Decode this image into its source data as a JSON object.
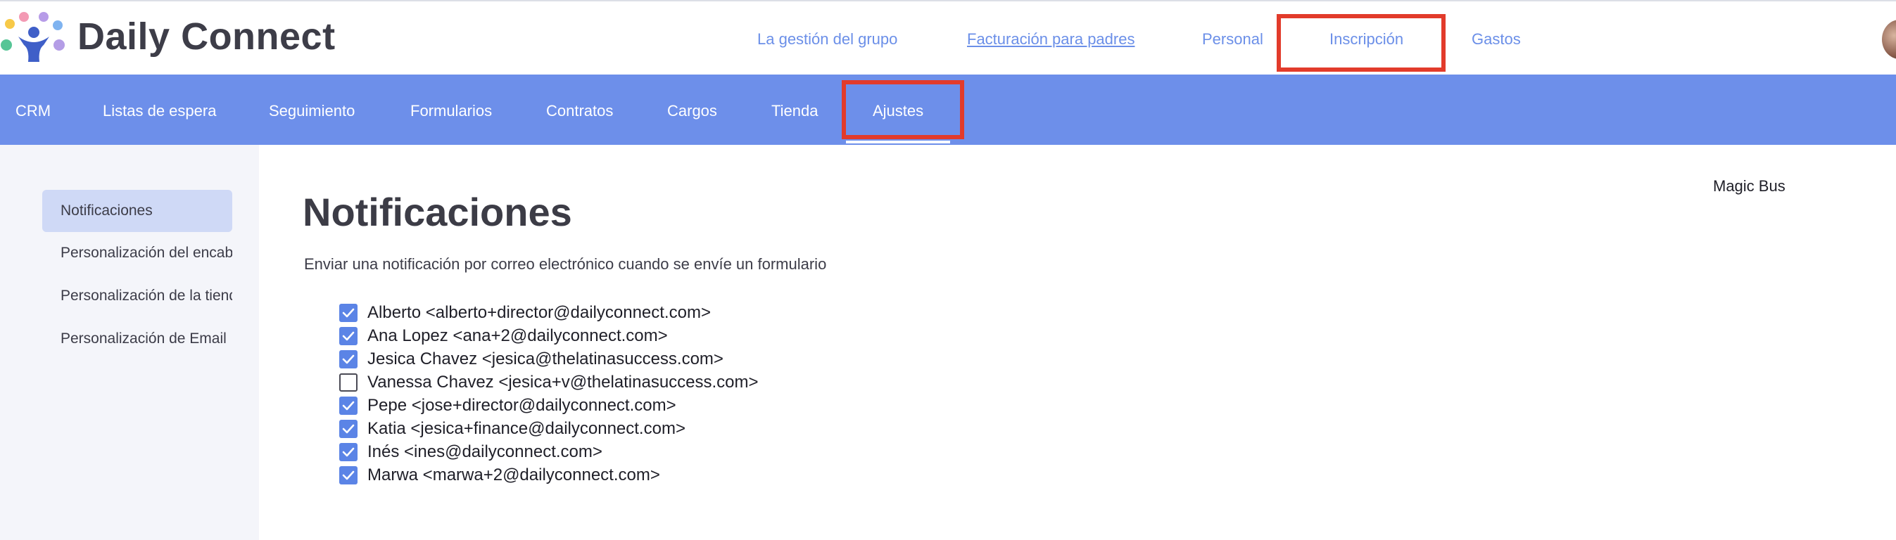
{
  "brand": {
    "name": "Daily Connect"
  },
  "top_nav": {
    "items": [
      {
        "label": "La gestión del grupo"
      },
      {
        "label": "Facturación para padres"
      },
      {
        "label": "Personal"
      },
      {
        "label": "Inscripción"
      },
      {
        "label": "Gastos"
      }
    ]
  },
  "sub_nav": {
    "items": [
      {
        "label": "CRM"
      },
      {
        "label": "Listas de espera"
      },
      {
        "label": "Seguimiento"
      },
      {
        "label": "Formularios"
      },
      {
        "label": "Contratos"
      },
      {
        "label": "Cargos"
      },
      {
        "label": "Tienda"
      },
      {
        "label": "Ajustes"
      }
    ],
    "school_select": {
      "value": "Magic Bus"
    }
  },
  "sidebar": {
    "items": [
      {
        "label": "Notificaciones"
      },
      {
        "label": "Personalización del encabezado"
      },
      {
        "label": "Personalización de la tienda"
      },
      {
        "label": "Personalización de Email"
      }
    ]
  },
  "main": {
    "title": "Notificaciones",
    "subtitle": "Enviar una notificación por correo electrónico cuando se envíe un formulario",
    "recipients": [
      {
        "label": "Alberto <alberto+director@dailyconnect.com>",
        "checked": true
      },
      {
        "label": "Ana Lopez <ana+2@dailyconnect.com>",
        "checked": true
      },
      {
        "label": "Jesica Chavez <jesica@thelatinasuccess.com>",
        "checked": true
      },
      {
        "label": "Vanessa Chavez <jesica+v@thelatinasuccess.com>",
        "checked": false
      },
      {
        "label": "Pepe <jose+director@dailyconnect.com>",
        "checked": true
      },
      {
        "label": "Katia <jesica+finance@dailyconnect.com>",
        "checked": true
      },
      {
        "label": "Inés <ines@dailyconnect.com>",
        "checked": true
      },
      {
        "label": "Marwa <marwa+2@dailyconnect.com>",
        "checked": true
      }
    ]
  },
  "colors": {
    "accent": "#6d8fea",
    "link": "#6b8fe8",
    "highlight": "#e23b2b",
    "checkbox": "#5b84e6"
  }
}
